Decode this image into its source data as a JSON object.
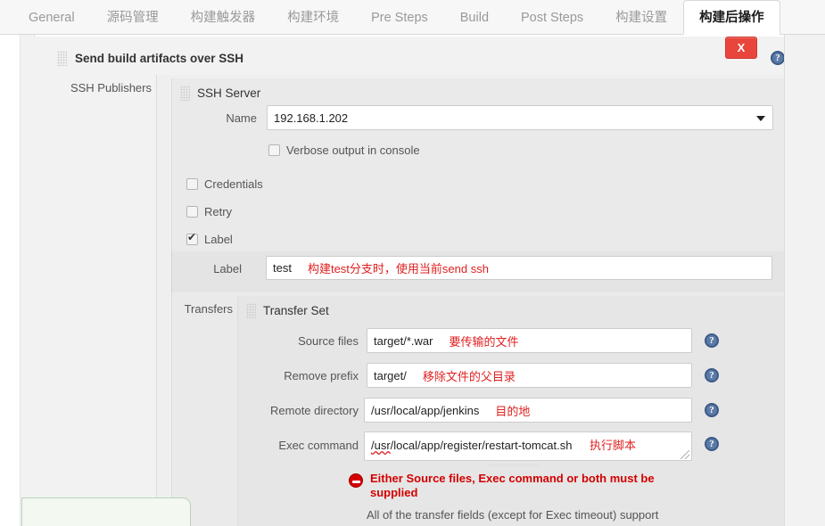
{
  "tabs": [
    {
      "label": "General",
      "active": false
    },
    {
      "label": "源码管理",
      "active": false
    },
    {
      "label": "构建触发器",
      "active": false
    },
    {
      "label": "构建环境",
      "active": false
    },
    {
      "label": "Pre Steps",
      "active": false
    },
    {
      "label": "Build",
      "active": false
    },
    {
      "label": "Post Steps",
      "active": false
    },
    {
      "label": "构建设置",
      "active": false
    },
    {
      "label": "构建后操作",
      "active": true
    }
  ],
  "block": {
    "title": "Send build artifacts over SSH",
    "delete_label": "X",
    "help_label": "?"
  },
  "publishers": {
    "label": "SSH Publishers"
  },
  "ssh_server": {
    "title": "SSH Server",
    "name_label": "Name",
    "name_value": "192.168.1.202",
    "verbose_label": "Verbose output in console",
    "verbose_checked": false,
    "credentials_label": "Credentials",
    "credentials_checked": false,
    "retry_label": "Retry",
    "retry_checked": false,
    "label_checkbox_label": "Label",
    "label_checked": true,
    "label_field_label": "Label",
    "label_field_value": "test",
    "label_field_annotation": "构建test分支时，使用当前send ssh"
  },
  "transfers": {
    "label": "Transfers",
    "set_title": "Transfer Set",
    "fields": [
      {
        "label": "Source files",
        "value": "target/*.war",
        "annotation": "要传输的文件"
      },
      {
        "label": "Remove prefix",
        "value": "target/",
        "annotation": "移除文件的父目录"
      },
      {
        "label": "Remote directory",
        "value": "/usr/local/app/jenkins",
        "annotation": "目的地"
      }
    ],
    "exec": {
      "label": "Exec command",
      "value_spell": "/usr",
      "value_rest": "/local/app/register/restart-tomcat.sh",
      "annotation": "执行脚本"
    },
    "error": "Either Source files, Exec command or both must be supplied",
    "hint": "All of the transfer fields (except for Exec timeout) support"
  },
  "colors": {
    "accent_red": "#e8453c",
    "annotation_red": "#e02020",
    "error_red": "#d40000",
    "help_blue": "#5b7aa8",
    "panel_bg": "#efefef",
    "tab_inactive": "#9a9a9a"
  }
}
